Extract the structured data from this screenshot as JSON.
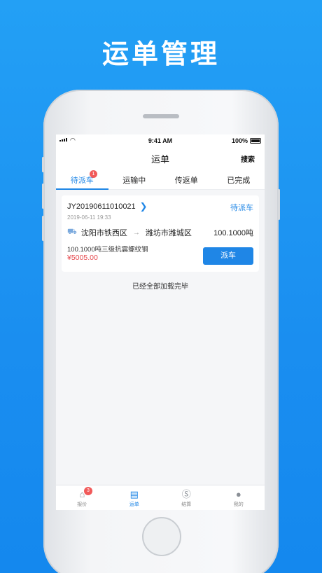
{
  "promo": {
    "title": "运单管理"
  },
  "status_bar": {
    "time": "9:41 AM",
    "battery": "100%"
  },
  "navbar": {
    "title": "运单",
    "search_label": "搜索"
  },
  "tabs": [
    {
      "label": "待派车",
      "badge": "1",
      "active": true
    },
    {
      "label": "运输中"
    },
    {
      "label": "传返单"
    },
    {
      "label": "已完成"
    }
  ],
  "order": {
    "number": "JY20190611010021",
    "status": "待派车",
    "date": "2019-06-11 19:33",
    "origin": "沈阳市铁西区",
    "destination": "潍坊市潍城区",
    "weight": "100.1000吨",
    "cargo": "100.1000吨三级抗震螺纹钢",
    "price": "¥5005.00",
    "dispatch_label": "派车"
  },
  "list_footer": "已经全部加载完毕",
  "bottom_nav": [
    {
      "label": "报价",
      "icon": "quote-icon",
      "badge": "3"
    },
    {
      "label": "运单",
      "icon": "waybill-icon",
      "active": true
    },
    {
      "label": "结算",
      "icon": "settlement-icon"
    },
    {
      "label": "我的",
      "icon": "profile-icon"
    }
  ],
  "colors": {
    "accent": "#1f86e6",
    "badge": "#f15a5a",
    "price": "#e5484d",
    "background": "#1a8ef0"
  }
}
